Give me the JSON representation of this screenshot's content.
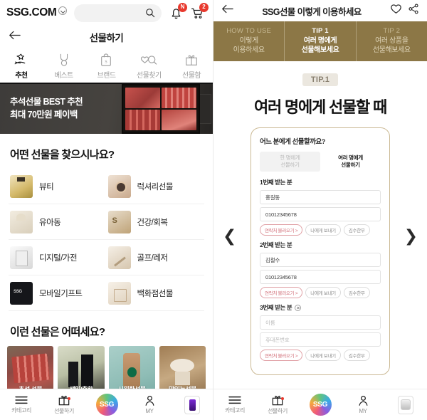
{
  "left": {
    "brand": "SSG.COM",
    "search_placeholder": "",
    "notification_badge": "N",
    "cart_badge": "2",
    "page_title": "선물하기",
    "tabs": [
      {
        "label": "추천",
        "icon": "hand-star-icon",
        "active": true
      },
      {
        "label": "베스트",
        "icon": "medal-icon",
        "active": false
      },
      {
        "label": "브랜드",
        "icon": "shopping-bag-icon",
        "active": false
      },
      {
        "label": "선물찾기",
        "icon": "hearts-search-icon",
        "active": false
      },
      {
        "label": "선물함",
        "icon": "gift-box-icon",
        "active": false
      }
    ],
    "hero": {
      "line1": "추석선물 BEST 추천",
      "line2": "최대 70만원 페이백"
    },
    "section1_title": "어떤 선물을 찾으시나요?",
    "categories": [
      {
        "label": "뷰티",
        "thumb": "th-beauty"
      },
      {
        "label": "럭셔리선물",
        "thumb": "th-luxury"
      },
      {
        "label": "유아동",
        "thumb": "th-kids"
      },
      {
        "label": "건강/회복",
        "thumb": "th-health"
      },
      {
        "label": "디지털/가전",
        "thumb": "th-digital"
      },
      {
        "label": "골프/레저",
        "thumb": "th-golf"
      },
      {
        "label": "모바일기프트",
        "thumb": "th-mobile"
      },
      {
        "label": "백화점선물",
        "thumb": "th-dept"
      }
    ],
    "section2_title": "이런 선물은 어떠세요?",
    "products": [
      {
        "label": "추석 선물"
      },
      {
        "label": "생일/축하"
      },
      {
        "label": "시원한선물"
      },
      {
        "label": "맛있는선물"
      }
    ],
    "bottom_nav": [
      {
        "label": "카테고리",
        "icon": "hamburger-icon"
      },
      {
        "label": "선물하기",
        "icon": "gift-icon"
      },
      {
        "label": "SSG",
        "icon": "ssg-orb-icon"
      },
      {
        "label": "MY",
        "icon": "person-icon"
      },
      {
        "label": "",
        "icon": "recent-product-thumbnail"
      }
    ]
  },
  "right": {
    "page_title": "SSG선물 이렇게 이용하세요",
    "like_icon": "heart-icon",
    "share_icon": "share-icon",
    "tabs": [
      {
        "eyebrow": "HOW TO USE",
        "line1": "이렇게",
        "line2": "이용하세요",
        "active": false
      },
      {
        "eyebrow": "TIP 1",
        "line1": "여러 명에게",
        "line2": "선물해보세요",
        "active": true
      },
      {
        "eyebrow": "TIP 2",
        "line1": "여러 상품을",
        "line2": "선물해보세요",
        "active": false
      }
    ],
    "tip_badge": "TIP.1",
    "tip_heading": "여러 명에게 선물할 때",
    "prev_icon": "chevron-left-icon",
    "next_icon": "chevron-right-icon",
    "form": {
      "question": "어느 분에게 선물할까요?",
      "segment": [
        {
          "line1": "한 명에게",
          "line2": "선물하기",
          "selected": false
        },
        {
          "line1": "여러 명에게",
          "line2": "선물하기",
          "selected": true
        }
      ],
      "recipients": [
        {
          "title": "1번째 받는 분",
          "removable": false,
          "name_value": "홍길동",
          "name_placeholder": "이름",
          "phone_value": "01012345678",
          "phone_placeholder": "휴대폰번호",
          "buttons": [
            "연락처 불러오기 >",
            "나에게 보내기",
            "김수한무"
          ]
        },
        {
          "title": "2번째 받는 분",
          "removable": false,
          "name_value": "김철수",
          "name_placeholder": "이름",
          "phone_value": "01012345678",
          "phone_placeholder": "휴대폰번호",
          "buttons": [
            "연락처 불러오기 >",
            "나에게 보내기",
            "김수한무"
          ]
        },
        {
          "title": "3번째 받는 분",
          "removable": true,
          "name_value": "",
          "name_placeholder": "이름",
          "phone_value": "",
          "phone_placeholder": "휴대폰번호",
          "buttons": [
            "연락처 불러오기 >",
            "나에게 보내기",
            "김수한무"
          ]
        }
      ]
    },
    "bottom_nav": [
      {
        "label": "카테고리",
        "icon": "hamburger-icon"
      },
      {
        "label": "선물하기",
        "icon": "gift-icon"
      },
      {
        "label": "SSG",
        "icon": "ssg-orb-icon"
      },
      {
        "label": "MY",
        "icon": "person-icon"
      },
      {
        "label": "",
        "icon": "recent-product-thumbnail"
      }
    ]
  },
  "theme": {
    "brown": "#8c7746",
    "accent_red": "#e8392e",
    "pink": "#d2707a"
  }
}
